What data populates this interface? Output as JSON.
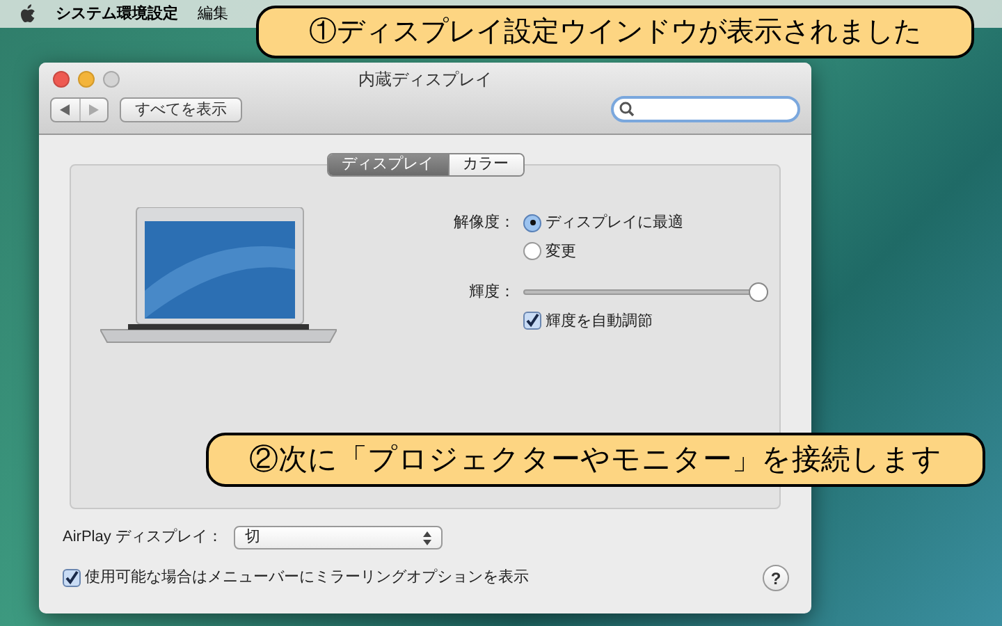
{
  "menu_bar": {
    "items": [
      "システム環境設定",
      "編集"
    ]
  },
  "window": {
    "title": "内蔵ディスプレイ",
    "show_all_button": "すべてを表示"
  },
  "tabs": [
    {
      "label": "ディスプレイ",
      "selected": true
    },
    {
      "label": "カラー",
      "selected": false
    }
  ],
  "resolution": {
    "label": "解像度：",
    "options": [
      {
        "label": "ディスプレイに最適",
        "selected": true
      },
      {
        "label": "変更",
        "selected": false
      }
    ]
  },
  "brightness": {
    "label": "輝度：",
    "level": 1,
    "auto": {
      "label": "輝度を自動調節",
      "checked": true
    }
  },
  "airplay": {
    "label": "AirPlay ディスプレイ：",
    "value": "切"
  },
  "mirroring": {
    "label": "使用可能な場合はメニューバーにミラーリングオプションを表示",
    "checked": true
  },
  "help_button": "?",
  "callouts": [
    {
      "text": "①ディスプレイ設定ウインドウが表示されました"
    },
    {
      "text": "②次に「プロジェクターやモニター」を接続します"
    }
  ]
}
